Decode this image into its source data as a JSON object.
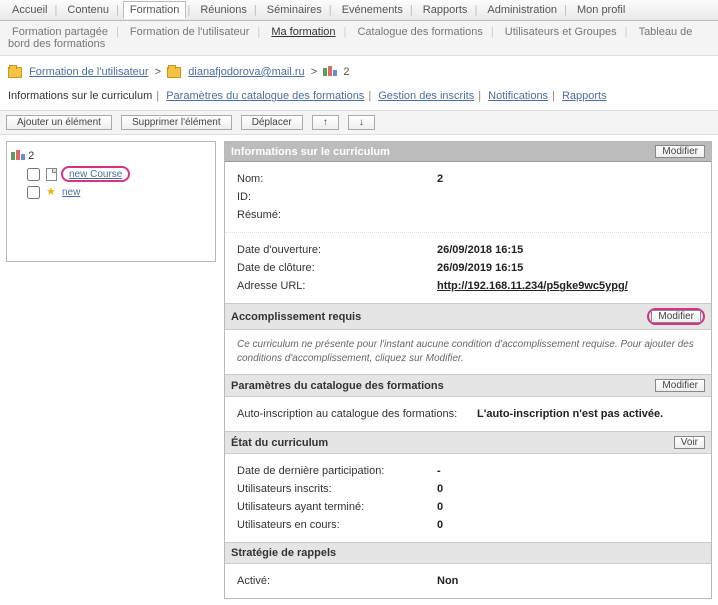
{
  "topnav": {
    "items": [
      "Accueil",
      "Contenu",
      "Formation",
      "Réunions",
      "Séminaires",
      "Evénements",
      "Rapports",
      "Administration",
      "Mon profil"
    ],
    "active": 2
  },
  "subnav": {
    "items": [
      "Formation partagée",
      "Formation de l'utilisateur",
      "Ma formation",
      "Catalogue des formations",
      "Utilisateurs et Groupes",
      "Tableau de bord des formations"
    ],
    "active": 2
  },
  "breadcrumb": {
    "link1": "Formation de l'utilisateur",
    "link2": "dianafjodorova@mail.ru",
    "current": "2"
  },
  "tabs": {
    "active": "Informations sur le curriculum",
    "items": [
      "Paramètres du catalogue des formations",
      "Gestion des inscrits",
      "Notifications",
      "Rapports"
    ]
  },
  "toolbar": {
    "add": "Ajouter un élément",
    "delete": "Supprimer l'élément",
    "move": "Déplacer",
    "up": "↑",
    "down": "↓"
  },
  "tree": {
    "root": "2",
    "item1": "new Course",
    "item2": "new"
  },
  "info": {
    "title": "Informations sur le curriculum",
    "modify": "Modifier",
    "rows": {
      "name_k": "Nom:",
      "name_v": "2",
      "id_k": "ID:",
      "id_v": "",
      "summary_k": "Résumé:",
      "summary_v": "",
      "open_k": "Date d'ouverture:",
      "open_v": "26/09/2018 16:15",
      "close_k": "Date de clôture:",
      "close_v": "26/09/2019 16:15",
      "url_k": "Adresse URL:",
      "url_v": "http://192.168.11.234/p5gke9wc5ypg/"
    }
  },
  "accomplish": {
    "title": "Accomplissement requis",
    "modify": "Modifier",
    "note": "Ce curriculum ne présente pour l'instant aucune condition d'accomplissement requise. Pour ajouter des conditions d'accomplissement, cliquez sur Modifier."
  },
  "catalog": {
    "title": "Paramètres du catalogue des formations",
    "modify": "Modifier",
    "k": "Auto-inscription au catalogue des formations:",
    "v": "L'auto-inscription n'est pas activée."
  },
  "status": {
    "title": "État du curriculum",
    "view": "Voir",
    "r1k": "Date de dernière participation:",
    "r1v": "-",
    "r2k": "Utilisateurs inscrits:",
    "r2v": "0",
    "r3k": "Utilisateurs ayant terminé:",
    "r3v": "0",
    "r4k": "Utilisateurs en cours:",
    "r4v": "0"
  },
  "reminder": {
    "title": "Stratégie de rappels",
    "k": "Activé:",
    "v": "Non"
  }
}
